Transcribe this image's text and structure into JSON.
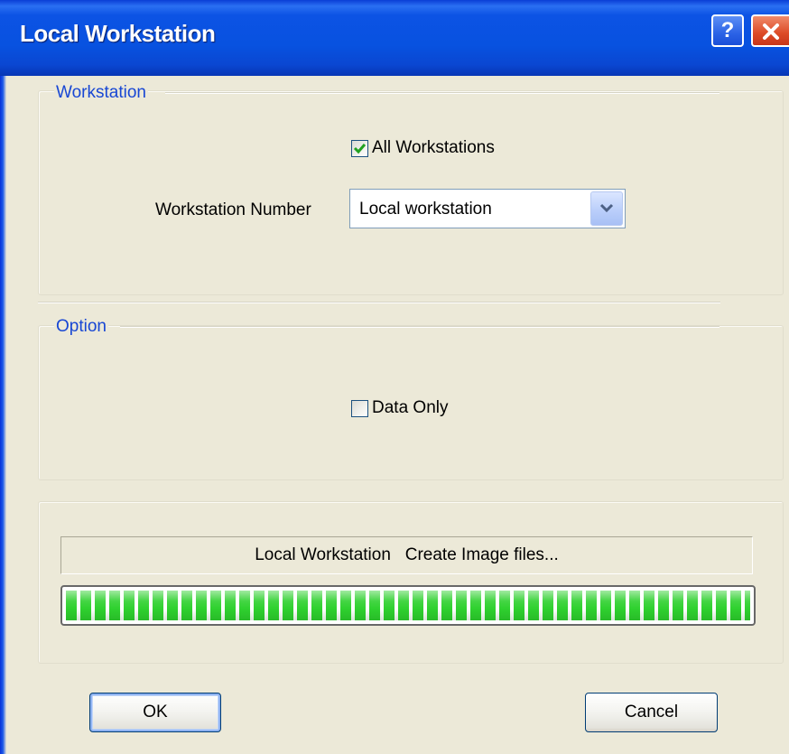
{
  "window": {
    "title": "Local Workstation"
  },
  "titlebar_buttons": {
    "help": "?"
  },
  "workstation_group": {
    "title": "Workstation",
    "all_workstations_label": "All Workstations",
    "all_workstations_checked": true,
    "number_label": "Workstation Number",
    "number_value": "Local workstation"
  },
  "option_group": {
    "title": "Option",
    "data_only_label": "Data Only",
    "data_only_checked": false
  },
  "progress_section": {
    "status_text": "Local Workstation   Create Image files...",
    "progress_fraction": 1.0
  },
  "buttons": {
    "ok": "OK",
    "cancel": "Cancel"
  },
  "icons": {
    "help": "help-icon",
    "close": "close-icon",
    "check": "check-icon",
    "dropdown": "chevron-down-icon"
  }
}
